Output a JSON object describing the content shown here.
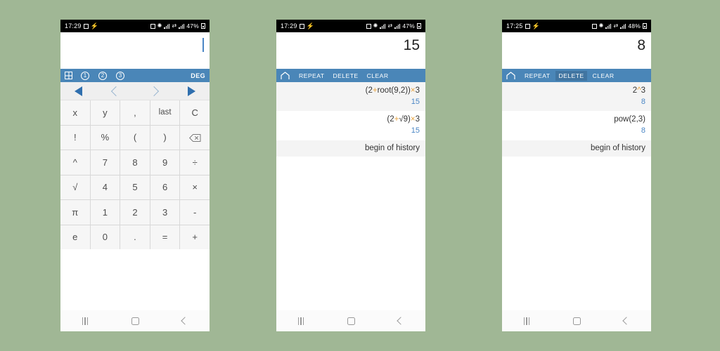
{
  "background_color": "#a0b795",
  "theme": {
    "toolbar_blue": "#4a86b8",
    "accent_orange": "#e8a33d",
    "result_blue": "#4a86c5",
    "key_bg": "#f6f6f6"
  },
  "phones": [
    {
      "id": "keypad-screen",
      "status_bar": {
        "time": "17:29",
        "battery": "47%"
      },
      "display": {
        "value": "",
        "caret_visible": true
      },
      "toolbar": {
        "grid_icon": "grid-icon",
        "memory_slots": [
          "1",
          "2",
          "3"
        ],
        "angle_mode": "DEG"
      },
      "nav_arrows": [
        "prev-filled",
        "prev-outline",
        "next-outline",
        "next-filled"
      ],
      "keys": [
        "x",
        "y",
        ",",
        "last",
        "C",
        "!",
        "%",
        "(",
        ")",
        "backspace",
        "^",
        "7",
        "8",
        "9",
        "÷",
        "√",
        "4",
        "5",
        "6",
        "×",
        "π",
        "1",
        "2",
        "3",
        "-",
        "e",
        "0",
        ".",
        "=",
        "+"
      ],
      "nav_bar": [
        "recents",
        "home",
        "back"
      ]
    },
    {
      "id": "history-screen-root",
      "status_bar": {
        "time": "17:29",
        "battery": "47%"
      },
      "display": {
        "value": "15",
        "caret_visible": false
      },
      "toolbar": {
        "home_icon": "home-icon",
        "actions": [
          {
            "label": "REPEAT",
            "pressed": false
          },
          {
            "label": "DELETE",
            "pressed": false
          },
          {
            "label": "CLEAR",
            "pressed": false
          }
        ]
      },
      "history": [
        {
          "expr_parts": [
            {
              "t": "(2",
              "op": false
            },
            {
              "t": "+",
              "op": true
            },
            {
              "t": "root(9,2))",
              "op": false
            },
            {
              "t": "×",
              "op": true
            },
            {
              "t": "3",
              "op": false
            }
          ],
          "result": "15",
          "alt": true
        },
        {
          "expr_parts": [
            {
              "t": "(2",
              "op": false
            },
            {
              "t": "+",
              "op": true
            },
            {
              "t": "√9)",
              "op": false
            },
            {
              "t": "×",
              "op": true
            },
            {
              "t": "3",
              "op": false
            }
          ],
          "result": "15",
          "alt": false
        }
      ],
      "begin_label": "begin of history",
      "nav_bar": [
        "recents",
        "home",
        "back"
      ]
    },
    {
      "id": "history-screen-pow",
      "status_bar": {
        "time": "17:25",
        "battery": "48%"
      },
      "display": {
        "value": "8",
        "caret_visible": false
      },
      "toolbar": {
        "home_icon": "home-icon",
        "actions": [
          {
            "label": "REPEAT",
            "pressed": false
          },
          {
            "label": "DELETE",
            "pressed": true
          },
          {
            "label": "CLEAR",
            "pressed": false
          }
        ]
      },
      "history": [
        {
          "expr_parts": [
            {
              "t": "2",
              "op": false
            },
            {
              "t": "^",
              "op": true
            },
            {
              "t": "3",
              "op": false
            }
          ],
          "result": "8",
          "alt": true
        },
        {
          "expr_parts": [
            {
              "t": "pow(2,3)",
              "op": false
            }
          ],
          "result": "8",
          "alt": false
        }
      ],
      "begin_label": "begin of history",
      "nav_bar": [
        "recents",
        "home",
        "back"
      ]
    }
  ]
}
